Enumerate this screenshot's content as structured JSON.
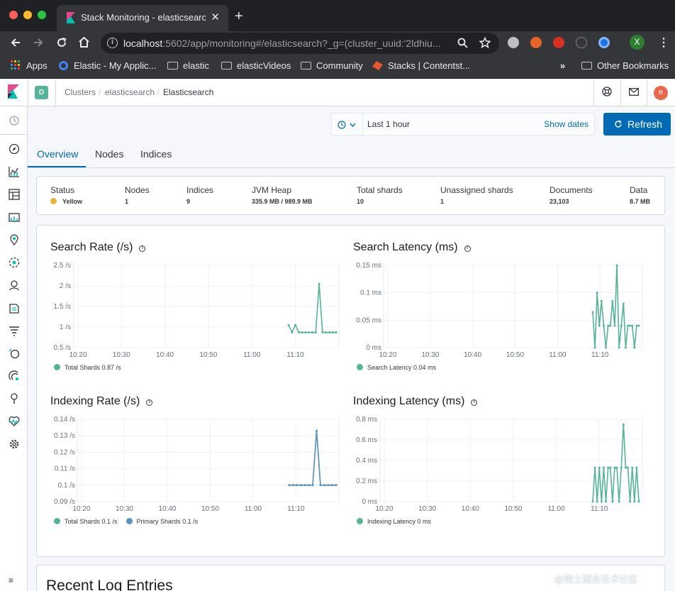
{
  "colors": {
    "teal": "#54b399",
    "blue": "#6092c0",
    "accent": "#006bb4",
    "status_yellow": "#e7b43f"
  },
  "browser": {
    "tab_title": "Stack Monitoring - elasticsearch",
    "close_glyph": "✕",
    "newtab_glyph": "+",
    "url_host": "localhost",
    "url_rest": ":5602/app/monitoring#/elasticsearch?_g=(cluster_uuid:'2ldhiu...",
    "profile_initial": "X",
    "bookmarks": [
      {
        "label": "Apps",
        "icon": "apps-grid-icon"
      },
      {
        "label": "Elastic - My Applic...",
        "icon": "elastic-circle-icon"
      },
      {
        "label": "elastic",
        "icon": "folder-icon"
      },
      {
        "label": "elasticVideos",
        "icon": "folder-icon"
      },
      {
        "label": "Community",
        "icon": "folder-icon"
      },
      {
        "label": "Stacks | Contentst...",
        "icon": "contentstack-icon"
      }
    ],
    "bookmarks_overflow": "»",
    "other_bookmarks": "Other Bookmarks"
  },
  "header": {
    "space_initial": "D",
    "breadcrumbs": [
      "Clusters",
      "elasticsearch",
      "Elasticsearch"
    ],
    "breadcrumb_sep": "/",
    "user_initial": "e"
  },
  "timepicker": {
    "range": "Last 1 hour",
    "show_dates": "Show dates",
    "refresh": "Refresh"
  },
  "tabs": [
    "Overview",
    "Nodes",
    "Indices"
  ],
  "summary": {
    "status": {
      "label": "Status",
      "value": "Yellow"
    },
    "nodes": {
      "label": "Nodes",
      "value": "1"
    },
    "indices": {
      "label": "Indices",
      "value": "9"
    },
    "jvm_heap": {
      "label": "JVM Heap",
      "value": "335.9 MB / 989.9 MB"
    },
    "total_shards": {
      "label": "Total shards",
      "value": "10"
    },
    "unassigned_shards": {
      "label": "Unassigned shards",
      "value": "1"
    },
    "documents": {
      "label": "Documents",
      "value": "23,103"
    },
    "data": {
      "label": "Data",
      "value": "8.7 MB"
    }
  },
  "chart_data": [
    {
      "type": "line",
      "title": "Search Rate (/s)",
      "x": [
        "11:08",
        "11:08.5",
        "11:09",
        "11:09.5",
        "11:10",
        "11:11",
        "11:12",
        "11:13",
        "11:14",
        "11:14.5",
        "11:15",
        "11:16",
        "11:17",
        "11:18",
        "11:19"
      ],
      "yticks": [
        "2.5 /s",
        "2 /s",
        "1.5 /s",
        "1 /s",
        "0.5 /s"
      ],
      "ylim": [
        0.5,
        2.5
      ],
      "xticks": [
        "10:20",
        "10:30",
        "10:40",
        "10:50",
        "11:00",
        "11:10"
      ],
      "series": [
        {
          "name": "Total Shards",
          "legend": "Total Shards 0.87 /s",
          "color": "#54b399",
          "values": [
            1.05,
            0.87,
            1.05,
            0.87,
            0.87,
            0.87,
            0.87,
            0.87,
            0.87,
            2.05,
            0.87,
            0.87,
            0.87,
            0.87,
            0.87
          ]
        }
      ]
    },
    {
      "type": "line",
      "title": "Search Latency (ms)",
      "x": [
        "11:08",
        "11:08.5",
        "11:09",
        "11:09.5",
        "11:10",
        "11:10.5",
        "11:11",
        "11:11.5",
        "11:12",
        "11:12.5",
        "11:13",
        "11:13.5",
        "11:14",
        "11:14.5",
        "11:15",
        "11:15.5",
        "11:16",
        "11:16.5",
        "11:17",
        "11:17.5",
        "11:18",
        "11:18.5"
      ],
      "yticks": [
        "0.15 ms",
        "0.1 ms",
        "0.05 ms",
        "0 ms"
      ],
      "ylim": [
        0,
        0.15
      ],
      "xticks": [
        "10:20",
        "10:30",
        "10:40",
        "10:50",
        "11:00",
        "11:10"
      ],
      "series": [
        {
          "name": "Search Latency",
          "legend": "Search Latency 0.04 ms",
          "color": "#54b399",
          "values": [
            0.065,
            0,
            0.1,
            0.04,
            0.085,
            0.04,
            0,
            0.04,
            0.04,
            0.085,
            0.04,
            0.15,
            0,
            0.04,
            0.08,
            0,
            0.04,
            0.04,
            0.04,
            0,
            0.04,
            0.04
          ]
        }
      ]
    },
    {
      "type": "line",
      "title": "Indexing Rate (/s)",
      "x": [
        "11:08",
        "11:09",
        "11:10",
        "11:11",
        "11:12",
        "11:13",
        "11:14",
        "11:14.5",
        "11:15",
        "11:16",
        "11:17",
        "11:18",
        "11:19"
      ],
      "yticks": [
        "0.14 /s",
        "0.13 /s",
        "0.12 /s",
        "0.11 /s",
        "0.1 /s",
        "0.09 /s"
      ],
      "ylim": [
        0.09,
        0.14
      ],
      "xticks": [
        "10:20",
        "10:30",
        "10:40",
        "10:50",
        "11:00",
        "11:10"
      ],
      "series": [
        {
          "name": "Total Shards",
          "legend": "Total Shards 0.1 /s",
          "color": "#54b399",
          "values": [
            0.1,
            0.1,
            0.1,
            0.1,
            0.1,
            0.1,
            0.1,
            0.133,
            0.1,
            0.1,
            0.1,
            0.1,
            0.1
          ]
        },
        {
          "name": "Primary Shards",
          "legend": "Primary Shards 0.1 /s",
          "color": "#6092c0",
          "values": [
            0.1,
            0.1,
            0.1,
            0.1,
            0.1,
            0.1,
            0.1,
            0.133,
            0.1,
            0.1,
            0.1,
            0.1,
            0.1
          ]
        }
      ]
    },
    {
      "type": "line",
      "title": "Indexing Latency (ms)",
      "x": [
        "11:08",
        "11:08.5",
        "11:09",
        "11:09.5",
        "11:10",
        "11:10.5",
        "11:11",
        "11:11.5",
        "11:12",
        "11:12.5",
        "11:13",
        "11:13.5",
        "11:14",
        "11:14.5",
        "11:15",
        "11:15.5",
        "11:16",
        "11:16.5",
        "11:17",
        "11:17.5",
        "11:18",
        "11:18.5"
      ],
      "yticks": [
        "0.8 ms",
        "0.6 ms",
        "0.4 ms",
        "0.2 ms",
        "0 ms"
      ],
      "ylim": [
        0,
        0.8
      ],
      "xticks": [
        "10:20",
        "10:30",
        "10:40",
        "10:50",
        "11:00",
        "11:10"
      ],
      "series": [
        {
          "name": "Indexing Latency",
          "legend": "Indexing Latency 0 ms",
          "color": "#54b399",
          "values": [
            0,
            0.33,
            0,
            0.33,
            0,
            0.33,
            0,
            0.33,
            0.33,
            0,
            0.33,
            0.33,
            0,
            0.33,
            0.75,
            0.33,
            0.33,
            0,
            0.33,
            0,
            0.33,
            0
          ]
        }
      ]
    }
  ],
  "log_section_title": "Recent Log Entries",
  "collapse_glyph": "≡",
  "watermark": "@稀土掘金技术社区"
}
